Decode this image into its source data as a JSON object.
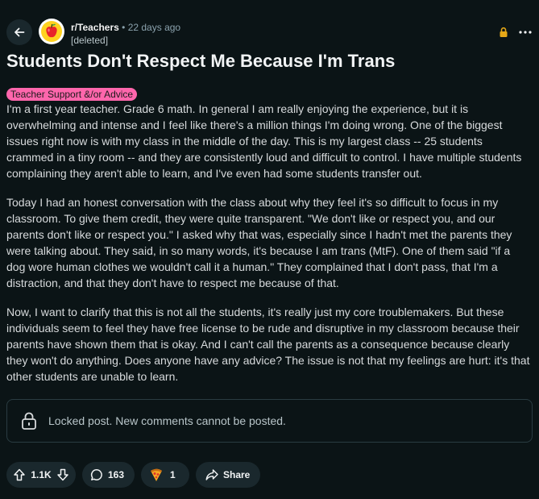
{
  "header": {
    "subreddit": "r/Teachers",
    "separator": "•",
    "time": "22 days ago",
    "author": "[deleted]"
  },
  "post": {
    "title": "Students Don't Respect Me Because I'm Trans",
    "flair": "Teacher Support &/or Advice",
    "flair_color": "#ff66ac",
    "paragraphs": [
      "I'm a first year teacher. Grade 6 math. In general I am really enjoying the experience, but it is overwhelming and intense and I feel like there's a million things I'm doing wrong. One of the biggest issues right now is with my class in the middle of the day. This is my largest class -- 25 students crammed in a tiny room -- and they are consistently loud and difficult to control. I have multiple students complaining they aren't able to learn, and I've even had some students transfer out.",
      "Today I had an honest conversation with the class about why they feel it's so difficult to focus in my classroom. To give them credit, they were quite transparent. \"We don't like or respect you, and our parents don't like or respect you.\" I asked why that was, especially since I hadn't met the parents they were talking about. They said, in so many words, it's because I am trans (MtF). One of them said \"if a dog wore human clothes we wouldn't call it a human.\" They complained that I don't pass, that I'm a distraction, and that they don't have to respect me because of that.",
      "Now, I want to clarify that this is not all the students, it's really just my core troublemakers. But these individuals seem to feel they have free license to be rude and disruptive in my classroom because their parents have shown them that is okay. And I can't call the parents as a consequence because clearly they won't do anything. Does anyone have any advice? The issue is not that my feelings are hurt: it's that other students are unable to learn."
    ]
  },
  "locked_notice": "Locked post. New comments cannot be posted.",
  "actions": {
    "votes": "1.1K",
    "comments": "163",
    "awards": "1",
    "share": "Share"
  },
  "colors": {
    "background": "#0b1416",
    "pill": "#1a282d",
    "lock_accent": "#e6a817"
  }
}
